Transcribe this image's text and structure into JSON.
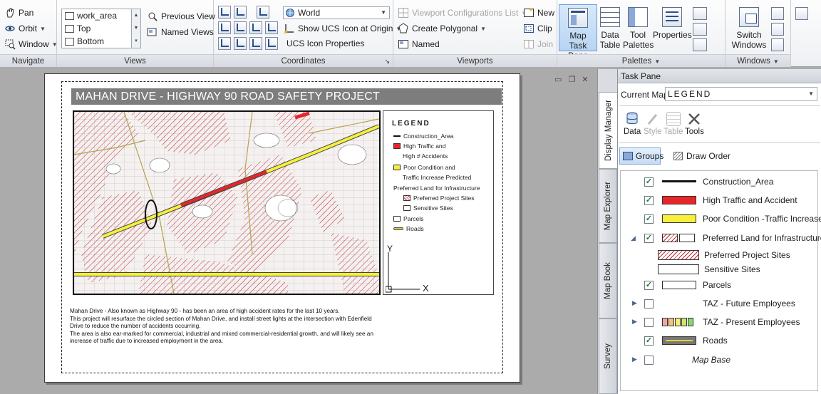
{
  "ribbon": {
    "navigate": {
      "title": "Navigate",
      "pan": "Pan",
      "orbit": "Orbit",
      "window": "Window"
    },
    "views": {
      "title": "Views",
      "list": [
        "work_area",
        "Top",
        "Bottom"
      ],
      "previous_views": "Previous View",
      "named_views": "Named Views"
    },
    "coordinates": {
      "title": "Coordinates",
      "world": "World",
      "show_ucs_icon": "Show UCS Icon at Origin",
      "ucs_icon_properties": "UCS Icon Properties"
    },
    "viewports": {
      "title": "Viewports",
      "config_list": "Viewport Configurations List",
      "create_polygonal": "Create Polygonal",
      "named": "Named",
      "new": "New",
      "clip": "Clip",
      "join": "Join"
    },
    "palettes": {
      "title": "Palettes",
      "map_task_pane_line1": "Map",
      "map_task_pane_line2": "Task Pane",
      "data_table_line1": "Data",
      "data_table_line2": "Table",
      "tool_palettes_line1": "Tool",
      "tool_palettes_line2": "Palettes",
      "properties": "Properties"
    },
    "windows": {
      "title": "Windows",
      "switch_windows_line1": "Switch",
      "switch_windows_line2": "Windows"
    }
  },
  "sheet": {
    "title": "MAHAN DRIVE - HIGHWAY 90 ROAD SAFETY PROJECT",
    "legend": {
      "title": "LEGEND",
      "items": [
        "Construction_Area",
        "High Traffic and",
        "High # Accidents",
        "Poor Condition and",
        "Traffic Increase Predicted",
        "Preferred Land for Infrastructure",
        "Preferred Project Sites",
        "Sensitive Sites",
        "Parcels",
        "Roads"
      ]
    },
    "description": [
      "Mahan Drive - Also known as Highway 90 - has been an area of high accident rates for the last 10 years.",
      "This project will resurface the circled section of Mahan Drive, and install street lights at the intersection with Edenfield",
      "Drive to reduce the number of accidents occurring.",
      "The area is also ear-marked for commercial, industrial and mixed commercial-residential growth, and will likely see an",
      "increase of traffic due to increased employment in the area."
    ],
    "ucs_y": "Y",
    "ucs_x": "X"
  },
  "task_pane": {
    "header": "Task Pane",
    "current_map_label": "Current Map:",
    "current_map_value": "LEGEND",
    "tools": [
      "Data",
      "Style",
      "Table",
      "Tools"
    ],
    "groups_button": "Groups",
    "draw_order_button": "Draw Order",
    "tabs": [
      "Display Manager",
      "Map Explorer",
      "Map Book",
      "Survey"
    ],
    "layers": [
      {
        "label": "Construction_Area",
        "checked": true
      },
      {
        "label": "High Traffic and Accident",
        "checked": true
      },
      {
        "label": "Poor Condition -Traffic Increase",
        "checked": true
      },
      {
        "label": "Preferred Land for Infrastructure",
        "checked": true
      },
      {
        "label": "Preferred Project Sites"
      },
      {
        "label": "Sensitive Sites"
      },
      {
        "label": "Parcels",
        "checked": true
      },
      {
        "label": "TAZ - Future Employees",
        "checked": false
      },
      {
        "label": "TAZ - Present Employees",
        "checked": false
      },
      {
        "label": "Roads",
        "checked": true
      },
      {
        "label": "Map Base",
        "checked": false
      }
    ]
  },
  "colors": {
    "accent": "#b8d4f3",
    "high_traffic": "#e8262a",
    "poor_condition": "#f6f03a",
    "hatch": "#c0282e",
    "road": "#d8c84a"
  }
}
